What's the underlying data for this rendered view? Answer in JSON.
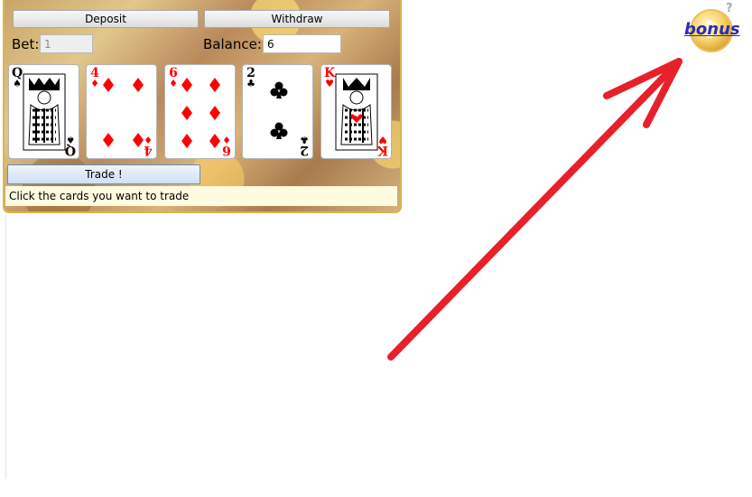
{
  "toolbar": {
    "deposit_label": "Deposit",
    "withdraw_label": "Withdraw"
  },
  "bet": {
    "label": "Bet:",
    "value": "1"
  },
  "balance": {
    "label": "Balance:",
    "value": "6"
  },
  "cards": [
    {
      "rank": "Q",
      "suit": "♠",
      "color": "#000000"
    },
    {
      "rank": "4",
      "suit": "♦",
      "color": "#ff0000"
    },
    {
      "rank": "6",
      "suit": "♦",
      "color": "#ff0000"
    },
    {
      "rank": "2",
      "suit": "♣",
      "color": "#000000"
    },
    {
      "rank": "K",
      "suit": "♥",
      "color": "#ff0000"
    }
  ],
  "trade": {
    "label": "Trade !"
  },
  "status": {
    "message": "Click the cards you want to trade"
  },
  "bonus": {
    "label": "bonus",
    "help": "?"
  },
  "colors": {
    "arrow": "#e8202a",
    "panel_border": "#d7b64f",
    "link": "#2b2bb8"
  }
}
